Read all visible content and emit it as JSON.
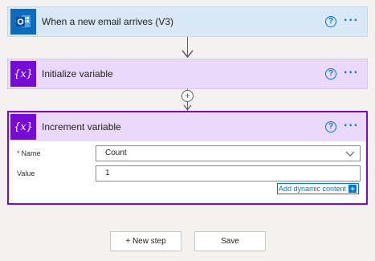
{
  "cards": {
    "trigger": {
      "title": "When a new email arrives (V3)",
      "icon": "outlook-icon"
    },
    "init": {
      "title": "Initialize variable",
      "icon": "variable-icon"
    },
    "increment": {
      "title": "Increment variable",
      "icon": "variable-icon",
      "fields": {
        "name_label": "Name",
        "name_required": "*",
        "name_value": "Count",
        "value_label": "Value",
        "value_value": "1"
      },
      "dynamic_content_label": "Add dynamic content",
      "dynamic_content_icon": "+"
    }
  },
  "common": {
    "help_icon": "?",
    "more_icon": "···",
    "add_icon": "+",
    "variable_glyph": "{x}"
  },
  "buttons": {
    "new_step": "+ New step",
    "save": "Save"
  },
  "colors": {
    "accent": "#0078d4",
    "variable_purple": "#770bd6",
    "outlook_blue": "#0f6cbd",
    "trigger_header": "#d9e8f6",
    "variable_header": "#ead9fa"
  }
}
